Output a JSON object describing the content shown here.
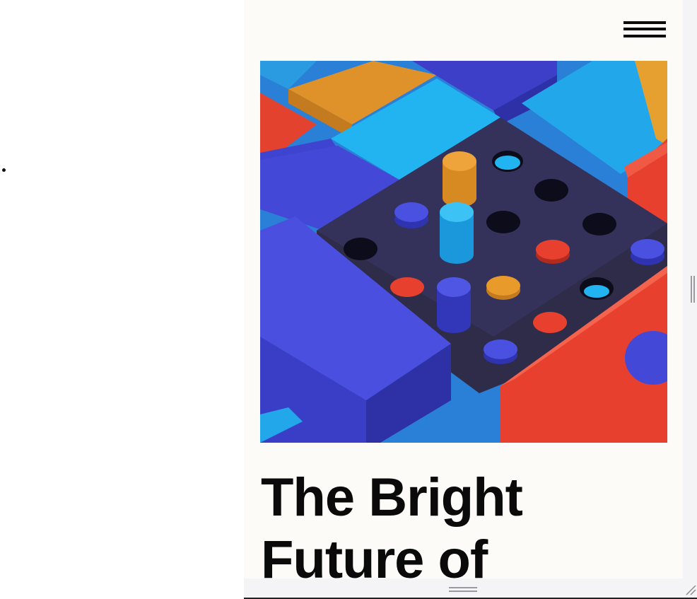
{
  "article": {
    "title": "The Bright Future of"
  },
  "hero_image": {
    "alt": "Colorful 3D toy blocks and peg board"
  },
  "icons": {
    "menu": "hamburger-menu-icon",
    "vertical_resize": "vertical-resize-handle-icon",
    "horizontal_resize": "horizontal-resize-handle-icon",
    "corner_resize": "corner-resize-grip-icon"
  },
  "colors": {
    "page_background": "#ffffff",
    "preview_background": "#fcfbf8",
    "title_text": "#0a0a0a",
    "block_blue": "#4147d8",
    "block_cyan": "#22b6f2",
    "block_red": "#e8402f",
    "block_orange": "#e89a2a",
    "peg_board": "#2e2c48"
  }
}
